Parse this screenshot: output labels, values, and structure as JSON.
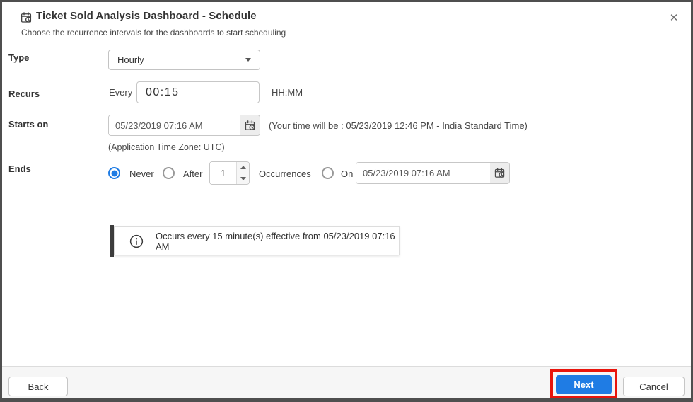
{
  "colors": {
    "accent": "#1f7ce4",
    "highlight": "#e8150d",
    "bar-dark": "#3d3d3d"
  },
  "icons": {
    "close": "✕",
    "title_icon": "schedule-calendar-clock",
    "date_icon": "calendar-clock",
    "info_icon": "info-circle"
  },
  "header": {
    "title": "Ticket Sold Analysis Dashboard - Schedule",
    "subtitle": "Choose the recurrence intervals for the dashboards to start scheduling"
  },
  "form": {
    "type": {
      "label": "Type",
      "value": "Hourly"
    },
    "recurs": {
      "label": "Recurs",
      "prefix": "Every",
      "value": "00:15",
      "hint": "HH:MM"
    },
    "starts_on": {
      "label": "Starts on",
      "value": "05/23/2019 07:16 AM",
      "local_note": "(Your time will be : 05/23/2019 12:46 PM - India Standard Time)",
      "tz_note": "(Application Time Zone: UTC)"
    },
    "ends": {
      "label": "Ends",
      "never": "Never",
      "after": "After",
      "occurrences_value": "1",
      "occurrences": "Occurrences",
      "on": "On",
      "on_value": "05/23/2019 07:16 AM"
    }
  },
  "info": {
    "message": "Occurs every 15 minute(s) effective from 05/23/2019 07:16 AM"
  },
  "footer": {
    "back": "Back",
    "next": "Next",
    "cancel": "Cancel"
  }
}
